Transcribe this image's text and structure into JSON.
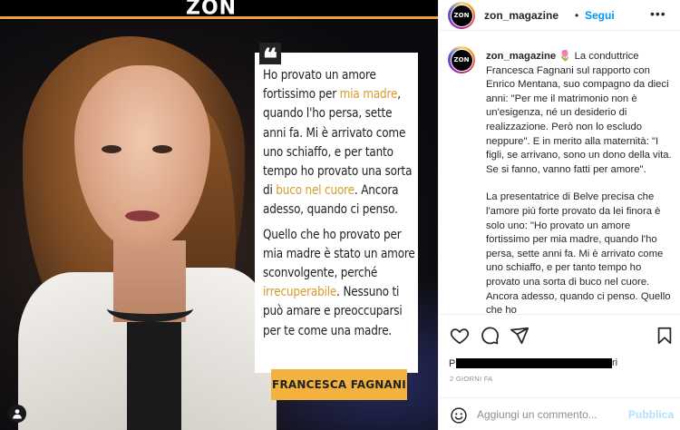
{
  "post": {
    "logo": "ZON",
    "quote_mark": "❝",
    "quote": {
      "p1_a": "Ho provato un amore fortissimo per ",
      "p1_hl1": "mia madre",
      "p1_b": ", quando l'ho persa, sette anni fa. Mi è arrivato come uno schiaffo, e per tanto tempo ho provato una sorta di ",
      "p1_hl2": "buco nel cuore",
      "p1_c": ". Ancora adesso, quando ci penso.",
      "p2_a": "Quello che ho provato per mia madre è stato un amore sconvolgente, perché ",
      "p2_hl": "irrecuperabile",
      "p2_b": ". Nessuno ti può amare e preoccuparsi per te come una madre."
    },
    "name_tag": "FRANCESCA FAGNANI",
    "accent_color": "#f3b23d",
    "highlight_color": "#d99a2b"
  },
  "header": {
    "avatar_text": "ZON",
    "username": "zon_magazine",
    "dot": "•",
    "follow_label": "Segui",
    "more": "•••"
  },
  "caption": {
    "username": "zon_magazine",
    "emoji": "🌷",
    "p1": "La conduttrice Francesca Fagnani sul rapporto con Enrico Mentana, suo compagno da dieci anni: \"Per me il matrimonio non è un'esigenza, né un desiderio di realizzazione. Però non lo escludo neppure\". E in merito alla maternità: \"I figli, se arrivano, sono un dono della vita. Se si fanno, vanno fatti per amore\".",
    "p2": "La presentatrice di Belve precisa che l'amore più forte provato da lei finora è solo uno: \"Ho provato un amore fortissimo per mia madre, quando l'ho persa, sette anni fa. Mi è arrivato come uno schiaffo, e per tanto tempo ho provato una sorta di buco nel cuore. Ancora adesso, quando ci penso. Quello che ho"
  },
  "likes": {
    "prefix": "P",
    "suffix": "ri"
  },
  "date": "2 GIORNI FA",
  "comment": {
    "placeholder": "Aggiungi un commento...",
    "publish_label": "Pubblica"
  },
  "colors": {
    "brand_blue": "#0095f6",
    "publish_disabled": "#b2dffc"
  }
}
